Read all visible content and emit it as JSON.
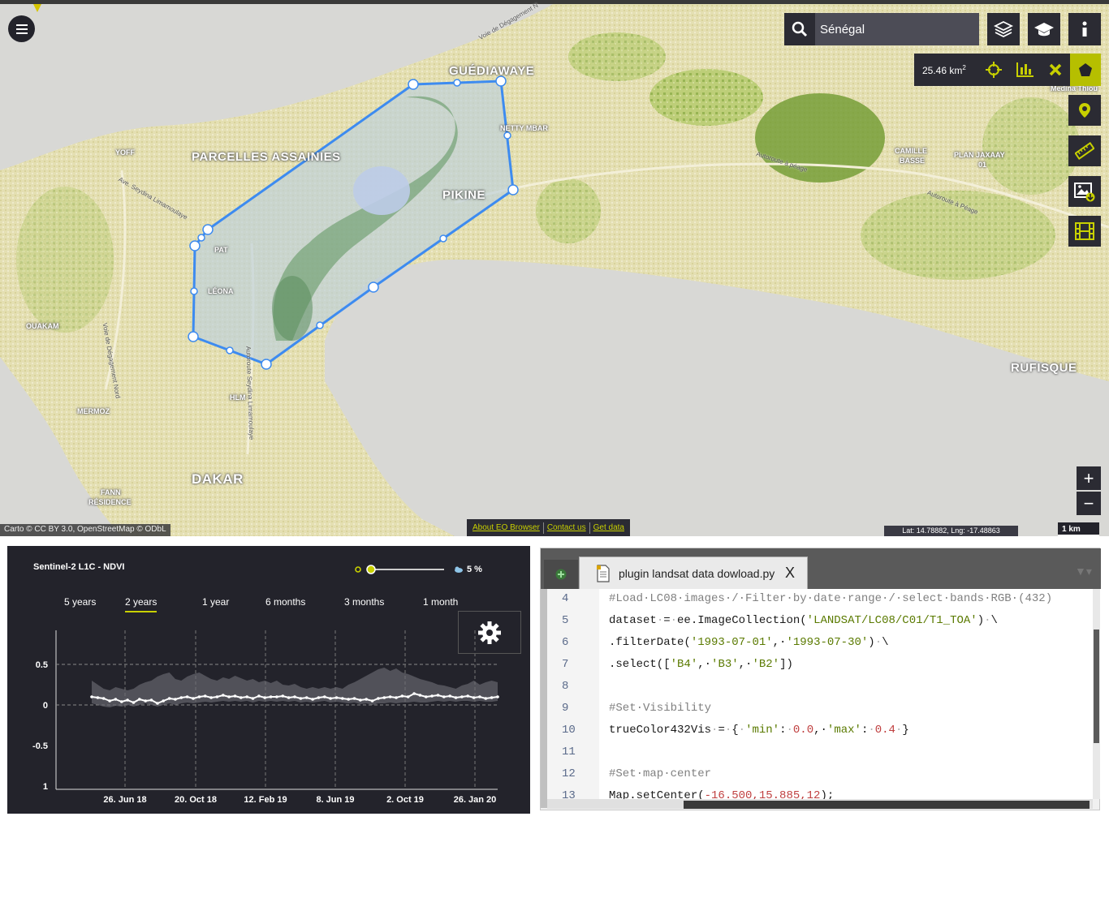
{
  "map": {
    "search": {
      "value": "Sénégal",
      "icon": "search-icon"
    },
    "toolbar": [
      "layers-icon",
      "graduation-cap-icon",
      "info-icon"
    ],
    "measure": {
      "area_value": "25.46 km",
      "area_unit_sup": "2",
      "buttons": [
        "move-icon",
        "bar-chart-icon",
        "close-icon",
        "pentagon-icon"
      ]
    },
    "side_tools": [
      "pin-icon",
      "ruler-icon",
      "image-download-icon",
      "film-icon"
    ],
    "zoom": {
      "in": "+",
      "out": "−"
    },
    "labels": {
      "guediawaye": "GUÉDIAWAYE",
      "parcelles": "PARCELLES ASSAINIES",
      "pikine": "PIKINE",
      "dakar": "DAKAR",
      "rufisque": "RUFISQUE",
      "yoff": "YOFF",
      "thiaroye": "NETTY MBAR",
      "pat": "PAT",
      "leona": "LÉONA",
      "ouakam": "OUAKAM",
      "mermoz": "MERMOZ",
      "hlm": "HLM",
      "fann": "FANN",
      "residence": "RÉSIDENCE",
      "camille": "CAMILLE",
      "basse": "BASSE",
      "plan": "PLAN JAXAAY",
      "plan2": "01",
      "medina": "Medina Thiou",
      "road1": "Voie de Dégagement N",
      "road2": "Autoroute à péage",
      "road3": "Autoroute à Péage",
      "road4": "Ave. Seydina Limamoulaye",
      "road5": "Voie de Dégagement Nord",
      "road6": "Autoroute Seydina Limamoulaye"
    },
    "attribution": "Carto © CC BY 3.0, OpenStreetMap © ODbL",
    "links": [
      "About EO Browser",
      "Contact us",
      "Get data"
    ],
    "coords": "Lat: 14.78882, Lng: -17.48863",
    "scale": "1 km"
  },
  "chart_panel": {
    "title": "Sentinel-2 L1C - NDVI",
    "cloud_value": "5 %",
    "tabs": [
      "5 years",
      "2 years",
      "1 year",
      "6 months",
      "3 months",
      "1 month"
    ],
    "active_tab": "2 years",
    "settings_icon": "gear-icon"
  },
  "chart_data": {
    "type": "line",
    "title": "Sentinel-2 L1C - NDVI",
    "x_ticks": [
      "26. Jun 18",
      "20. Oct 18",
      "12. Feb 19",
      "8. Jun 19",
      "2. Oct 19",
      "26. Jan 20"
    ],
    "y_ticks": [
      "0.5",
      "0",
      "-0.5",
      "1"
    ],
    "ylim": [
      -1,
      1
    ],
    "grid": true,
    "series": [
      {
        "values": [
          0.1,
          0.09,
          0.08,
          0.05,
          0.07,
          0.04,
          0.06,
          0.03,
          0.07,
          0.05,
          0.06,
          0.02,
          0.05,
          0.08,
          0.07,
          0.09,
          0.1,
          0.08,
          0.1,
          0.11,
          0.09,
          0.1,
          0.12,
          0.1,
          0.11,
          0.09,
          0.1,
          0.08,
          0.11,
          0.09,
          0.1,
          0.1,
          0.11,
          0.09,
          0.1,
          0.08,
          0.09,
          0.07,
          0.09,
          0.1,
          0.08,
          0.09,
          0.08,
          0.07,
          0.08,
          0.06,
          0.07,
          0.05,
          0.08,
          0.09,
          0.1,
          0.09,
          0.11,
          0.1,
          0.14,
          0.12,
          0.1,
          0.11,
          0.12,
          0.1,
          0.11,
          0.09,
          0.1,
          0.11,
          0.09,
          0.1,
          0.08,
          0.09,
          0.1
        ]
      },
      {
        "values_upper": [
          0.3,
          0.25,
          0.2,
          0.18,
          0.22,
          0.2,
          0.18,
          0.2,
          0.25,
          0.28,
          0.3,
          0.35,
          0.38,
          0.4,
          0.32,
          0.3,
          0.35,
          0.38,
          0.4,
          0.36,
          0.32,
          0.3,
          0.34,
          0.32,
          0.36,
          0.33,
          0.3,
          0.32,
          0.28,
          0.3,
          0.27,
          0.3,
          0.25,
          0.24,
          0.26,
          0.22,
          0.2,
          0.22,
          0.2,
          0.22,
          0.2,
          0.22,
          0.2,
          0.25,
          0.28,
          0.32,
          0.36,
          0.4,
          0.44,
          0.46,
          0.42,
          0.45,
          0.4,
          0.38,
          0.35,
          0.32,
          0.3,
          0.28,
          0.25,
          0.24,
          0.22,
          0.2,
          0.24,
          0.26,
          0.3,
          0.25,
          0.28,
          0.3,
          0.28
        ],
        "values_lower": [
          0.02,
          0.0,
          -0.02,
          -0.03,
          -0.01,
          -0.02,
          0.0,
          -0.02,
          0.0,
          0.02,
          0.0,
          -0.02,
          0.0,
          0.02,
          0.0,
          0.02,
          0.03,
          0.02,
          0.03,
          0.04,
          0.03,
          0.04,
          0.05,
          0.04,
          0.05,
          0.04,
          0.05,
          0.03,
          0.05,
          0.04,
          0.05,
          0.04,
          0.05,
          0.04,
          0.05,
          0.03,
          0.04,
          0.03,
          0.04,
          0.05,
          0.03,
          0.04,
          0.03,
          0.02,
          0.03,
          0.01,
          0.02,
          0.0,
          0.02,
          0.02,
          0.03,
          0.02,
          0.03,
          0.03,
          0.04,
          0.03,
          0.03,
          0.04,
          0.05,
          0.04,
          0.05,
          0.04,
          0.05,
          0.05,
          0.04,
          0.05,
          0.04,
          0.04,
          0.05
        ]
      }
    ]
  },
  "editor": {
    "add_icon": "plus-icon",
    "file_icon": "file-icon",
    "filename": "plugin landsat data dowload.py",
    "close_icon": "X",
    "dropdown": "▼▾",
    "lines": [
      {
        "num": "4",
        "tokens": [
          [
            "c-com",
            "#Load·LC08·images·/·Filter·by·date·range·/·select·bands·RGB·(432)"
          ]
        ]
      },
      {
        "num": "5",
        "tokens": [
          [
            "",
            "dataset"
          ],
          [
            "c-dot",
            "·"
          ],
          [
            "",
            "="
          ],
          [
            "c-dot",
            "·"
          ],
          [
            "",
            "ee.ImageCollection("
          ],
          [
            "c-str",
            "'LANDSAT/LC08/C01/T1_TOA'"
          ],
          [
            "",
            ")"
          ],
          [
            "c-dot",
            "·"
          ],
          [
            "",
            "\\"
          ]
        ]
      },
      {
        "num": "6",
        "tokens": [
          [
            "",
            ".filterDate("
          ],
          [
            "c-str",
            "'1993-07-01'"
          ],
          [
            "",
            ",·"
          ],
          [
            "c-str",
            "'1993-07-30'"
          ],
          [
            "",
            ")"
          ],
          [
            "c-dot",
            "·"
          ],
          [
            "",
            "\\"
          ]
        ]
      },
      {
        "num": "7",
        "tokens": [
          [
            "",
            ".select(["
          ],
          [
            "c-str",
            "'B4'"
          ],
          [
            "",
            ",·"
          ],
          [
            "c-str",
            "'B3'"
          ],
          [
            "",
            ",·"
          ],
          [
            "c-str",
            "'B2'"
          ],
          [
            "",
            "])"
          ]
        ]
      },
      {
        "num": "8",
        "tokens": []
      },
      {
        "num": "9",
        "tokens": [
          [
            "c-com",
            "#Set·Visibility"
          ]
        ]
      },
      {
        "num": "10",
        "tokens": [
          [
            "",
            "trueColor432Vis"
          ],
          [
            "c-dot",
            "·"
          ],
          [
            "",
            "="
          ],
          [
            "c-dot",
            "·"
          ],
          [
            "",
            "{"
          ],
          [
            "c-dot",
            "·"
          ],
          [
            "c-str",
            "'min'"
          ],
          [
            "",
            ":"
          ],
          [
            "c-dot",
            "·"
          ],
          [
            "c-num",
            "0.0"
          ],
          [
            "",
            ",·"
          ],
          [
            "c-str",
            "'max'"
          ],
          [
            "",
            ":"
          ],
          [
            "c-dot",
            "·"
          ],
          [
            "c-num",
            "0.4"
          ],
          [
            "c-dot",
            "·"
          ],
          [
            "",
            "}"
          ]
        ]
      },
      {
        "num": "11",
        "tokens": []
      },
      {
        "num": "12",
        "tokens": [
          [
            "c-com",
            "#Set·map·center"
          ]
        ]
      },
      {
        "num": "13",
        "tokens": [
          [
            "",
            "Map.setCenter("
          ],
          [
            "c-num",
            "-16.500,15.885,12"
          ],
          [
            "",
            ");"
          ]
        ]
      }
    ]
  },
  "colors": {
    "accent": "#c8d000",
    "panel": "#23232b",
    "polygon": "#3d8bf0"
  }
}
